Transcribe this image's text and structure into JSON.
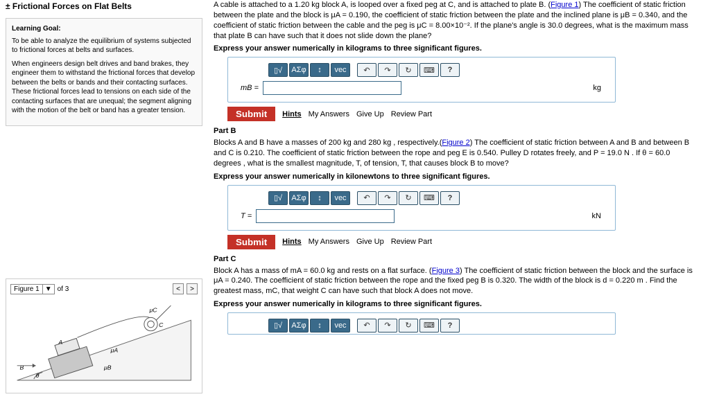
{
  "left": {
    "title": "± Frictional Forces on Flat Belts",
    "learning_goal_head": "Learning Goal:",
    "goal_p1": "To be able to analyze the equilibrium of systems subjected to frictional forces at belts and surfaces.",
    "goal_p2": "When engineers design belt drives and band brakes, they engineer them to withstand the frictional forces that develop between the belts or bands and their contacting surfaces. These frictional forces lead to tensions on each side of the contacting surfaces that are unequal; the segment aligning with the motion of the belt or band has a greater tension.",
    "figure_label": "Figure 1",
    "of_label": "of 3",
    "labels": {
      "muC": "μC",
      "C": "C",
      "A": "A",
      "muA": "μA",
      "muB": "μB",
      "B": "B",
      "theta": "θ"
    }
  },
  "partA": {
    "text_pre": "A cable is attached to a 1.20 kg block A, is looped over a fixed peg at C, and is attached to plate B. (",
    "fig_link": "Figure 1",
    "text_post": ") The coefficient of static friction between the plate and the block is μA = 0.190, the coefficient of static friction between the plate and the inclined plane is μB = 0.340, and the coefficient of static friction between the cable and the peg is μC = 8.00×10⁻². If the plane's angle is 30.0 degrees, what is the maximum mass that plate B can have such that it does not slide down the plane?",
    "instruct": "Express your answer numerically in kilograms to three significant figures.",
    "var": "mB =",
    "unit": "kg"
  },
  "partB": {
    "head": "Part B",
    "text_pre": "Blocks A and B have a masses of 200 kg and 280 kg , respectively.(",
    "fig_link": "Figure 2",
    "text_post": ") The coefficient of static friction between A and B and between B and C is 0.210. The coefficient of static friction between the rope and peg E is 0.540. Pulley D rotates freely, and P = 19.0 N . If θ = 60.0 degrees , what is the smallest magnitude, T, of tension, T, that causes block B to move?",
    "instruct": "Express your answer numerically in kilonewtons to three significant figures.",
    "var": "T =",
    "unit": "kN"
  },
  "partC": {
    "head": "Part C",
    "text_pre": "Block A has a mass of mA = 60.0 kg and rests on a flat surface. (",
    "fig_link": "Figure 3",
    "text_post": ") The coefficient of static friction between the block and the surface is μA = 0.240. The coefficient of static friction between the rope and the fixed peg B is 0.320. The width of the block is d = 0.220 m . Find the greatest mass, mC, that weight C can have such that block A does not move.",
    "instruct": "Express your answer numerically in kilograms to three significant figures."
  },
  "toolbar": {
    "t1": "▯√",
    "t2": "ΑΣφ",
    "t3": "↕",
    "t4": "vec",
    "undo": "↶",
    "redo": "↷",
    "reset": "↻",
    "key": "⌨",
    "help": "?"
  },
  "actions": {
    "submit": "Submit",
    "hints": "Hints",
    "myans": "My Answers",
    "giveup": "Give Up",
    "review": "Review Part"
  }
}
